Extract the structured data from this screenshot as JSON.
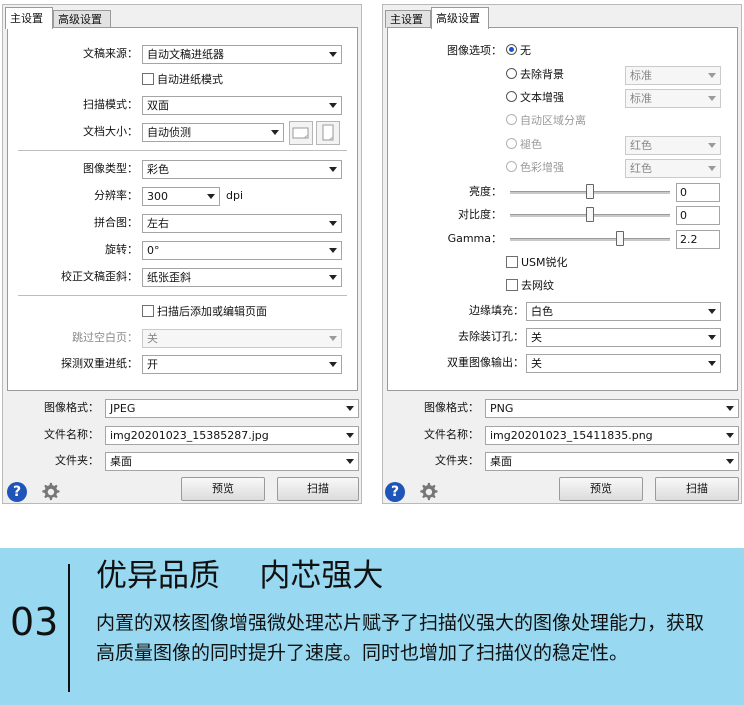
{
  "left": {
    "tabs": [
      "主设置",
      "高级设置"
    ],
    "rows": {
      "source": {
        "label": "文稿来源：",
        "value": "自动文稿进纸器"
      },
      "auto_feed": {
        "label": "自动进纸模式"
      },
      "scan_mode": {
        "label": "扫描模式：",
        "value": "双面"
      },
      "doc_size": {
        "label": "文档大小：",
        "value": "自动侦测"
      },
      "image_type": {
        "label": "图像类型：",
        "value": "彩色"
      },
      "resolution": {
        "label": "分辨率：",
        "value": "300",
        "unit": "dpi"
      },
      "stitch": {
        "label": "拼合图：",
        "value": "左右"
      },
      "rotate": {
        "label": "旋转：",
        "value": "0°"
      },
      "deskew": {
        "label": "校正文稿歪斜：",
        "value": "纸张歪斜"
      },
      "add_edit": {
        "label": "扫描后添加或编辑页面"
      },
      "skip_blank": {
        "label": "跳过空白页：",
        "value": "关"
      },
      "double_feed": {
        "label": "探测双重进纸：",
        "value": "开"
      }
    },
    "output": {
      "format": {
        "label": "图像格式：",
        "value": "JPEG"
      },
      "filename": {
        "label": "文件名称：",
        "value": "img20201023_15385287.jpg"
      },
      "folder": {
        "label": "文件夹：",
        "value": "桌面"
      }
    },
    "buttons": {
      "preview": "预览",
      "scan": "扫描"
    }
  },
  "right": {
    "tabs": [
      "主设置",
      "高级设置"
    ],
    "image_options": {
      "label": "图像选项：",
      "none": "无",
      "bg_remove": {
        "label": "去除背景",
        "value": "标准"
      },
      "text_enhance": {
        "label": "文本增强",
        "value": "标准"
      },
      "auto_area": "自动区域分离",
      "dropout": {
        "label": "褪色",
        "value": "红色"
      },
      "color_enhance": {
        "label": "色彩增强",
        "value": "红色"
      }
    },
    "brightness": {
      "label": "亮度：",
      "value": "0",
      "level": 0.5
    },
    "contrast": {
      "label": "对比度：",
      "value": "0",
      "level": 0.5
    },
    "gamma": {
      "label": "Gamma：",
      "value": "2.2",
      "level": 0.7
    },
    "usm": "USM锐化",
    "descreen": "去网纹",
    "edge_fill": {
      "label": "边缘填充：",
      "value": "白色"
    },
    "punch_hole": {
      "label": "去除装订孔：",
      "value": "关"
    },
    "dual_output": {
      "label": "双重图像输出：",
      "value": "关"
    },
    "output": {
      "format": {
        "label": "图像格式：",
        "value": "PNG"
      },
      "filename": {
        "label": "文件名称：",
        "value": "img20201023_15411835.png"
      },
      "folder": {
        "label": "文件夹：",
        "value": "桌面"
      }
    },
    "buttons": {
      "preview": "预览",
      "scan": "扫描"
    }
  },
  "banner": {
    "number": "03",
    "title": "优异品质    内芯强大",
    "description": "内置的双核图像增强微处理芯片赋予了扫描仪强大的图像处理能力，获取高质量图像的同时提升了速度。同时也增加了扫描仪的稳定性。",
    "color": "#98d8f0"
  },
  "icons": {
    "help": "help-icon",
    "settings": "gear-icon"
  }
}
